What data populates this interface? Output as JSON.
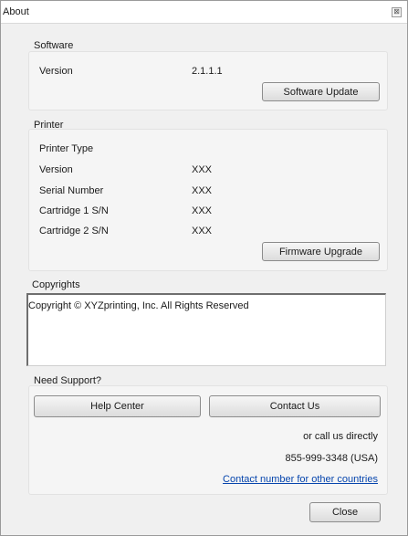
{
  "window": {
    "title": "About",
    "close_glyph": "⊠"
  },
  "software": {
    "title": "Software",
    "version_label": "Version",
    "version_value": "2.1.1.1",
    "update_button": "Software Update"
  },
  "printer": {
    "title": "Printer",
    "type_label": "Printer Type",
    "version_label": "Version",
    "version_value": "XXX",
    "serial_label": "Serial Number",
    "serial_value": "XXX",
    "cart1_label": "Cartridge 1 S/N",
    "cart1_value": "XXX",
    "cart2_label": "Cartridge 2 S/N",
    "cart2_value": "XXX",
    "firmware_button": "Firmware Upgrade"
  },
  "copyrights": {
    "title": "Copyrights",
    "text": "Copyright © XYZprinting, Inc. All Rights Reserved"
  },
  "support": {
    "title": "Need Support?",
    "help_button": "Help Center",
    "contact_button": "Contact Us",
    "call_text": "or call us directly",
    "phone": "855-999-3348 (USA)",
    "other_link": "Contact number for other countries"
  },
  "footer": {
    "close_button": "Close"
  },
  "colors": {
    "link": "#0645ad",
    "panel": "#f0f0f0"
  }
}
